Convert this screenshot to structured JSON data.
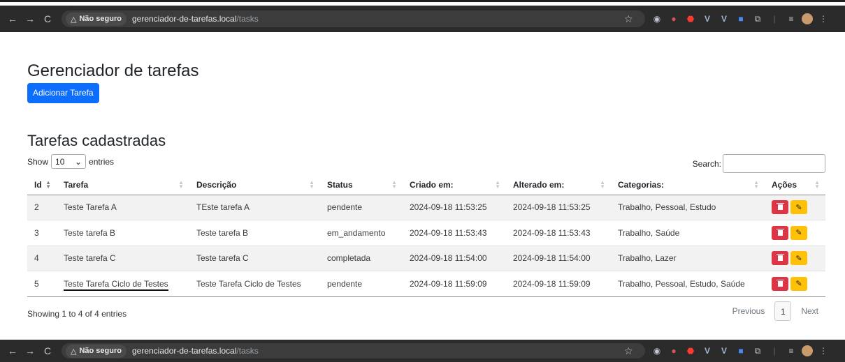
{
  "browser": {
    "security_label": "Não seguro",
    "url_host": "gerenciador-de-tarefas.local",
    "url_path": "/tasks"
  },
  "page": {
    "title": "Gerenciador de tarefas",
    "add_button": "Adicionar Tarefa",
    "section_title": "Tarefas cadastradas"
  },
  "datatable": {
    "show_label": "Show",
    "length_value": "10",
    "entries_label": "entries",
    "search_label": "Search:",
    "search_value": "",
    "columns": [
      "Id",
      "Tarefa",
      "Descrição",
      "Status",
      "Criado em:",
      "Alterado em:",
      "Categorias:",
      "Ações"
    ],
    "rows": [
      {
        "id": "2",
        "tarefa": "Teste Tarefa A",
        "descricao": "TEste tarefa A",
        "status": "pendente",
        "criado": "2024-09-18 11:53:25",
        "alterado": "2024-09-18 11:53:25",
        "categorias": "Trabalho, Pessoal, Estudo"
      },
      {
        "id": "3",
        "tarefa": "Teste tarefa B",
        "descricao": "Teste tarefa B",
        "status": "em_andamento",
        "criado": "2024-09-18 11:53:43",
        "alterado": "2024-09-18 11:53:43",
        "categorias": "Trabalho, Saúde"
      },
      {
        "id": "4",
        "tarefa": "Teste tarefa C",
        "descricao": "Teste tarefa C",
        "status": "completada",
        "criado": "2024-09-18 11:54:00",
        "alterado": "2024-09-18 11:54:00",
        "categorias": "Trabalho, Lazer"
      },
      {
        "id": "5",
        "tarefa": "Teste Tarefa Ciclo de Testes",
        "descricao": "Teste Tarefa Ciclo de Testes",
        "status": "pendente",
        "criado": "2024-09-18 11:59:09",
        "alterado": "2024-09-18 11:59:09",
        "categorias": "Trabalho, Pessoal, Estudo, Saúde"
      }
    ],
    "info": "Showing 1 to 4 of 4 entries",
    "previous": "Previous",
    "current_page": "1",
    "next": "Next"
  },
  "colors": {
    "primary": "#0d6efd",
    "danger": "#dc3545",
    "warning": "#ffc107",
    "browser_bar": "#2b2b2b"
  },
  "icons": [
    "back-icon",
    "forward-icon",
    "reload-icon",
    "warning-icon",
    "star-icon",
    "camera-icon",
    "trash-icon",
    "pencil-icon",
    "extensions-icon",
    "menu-icon"
  ]
}
